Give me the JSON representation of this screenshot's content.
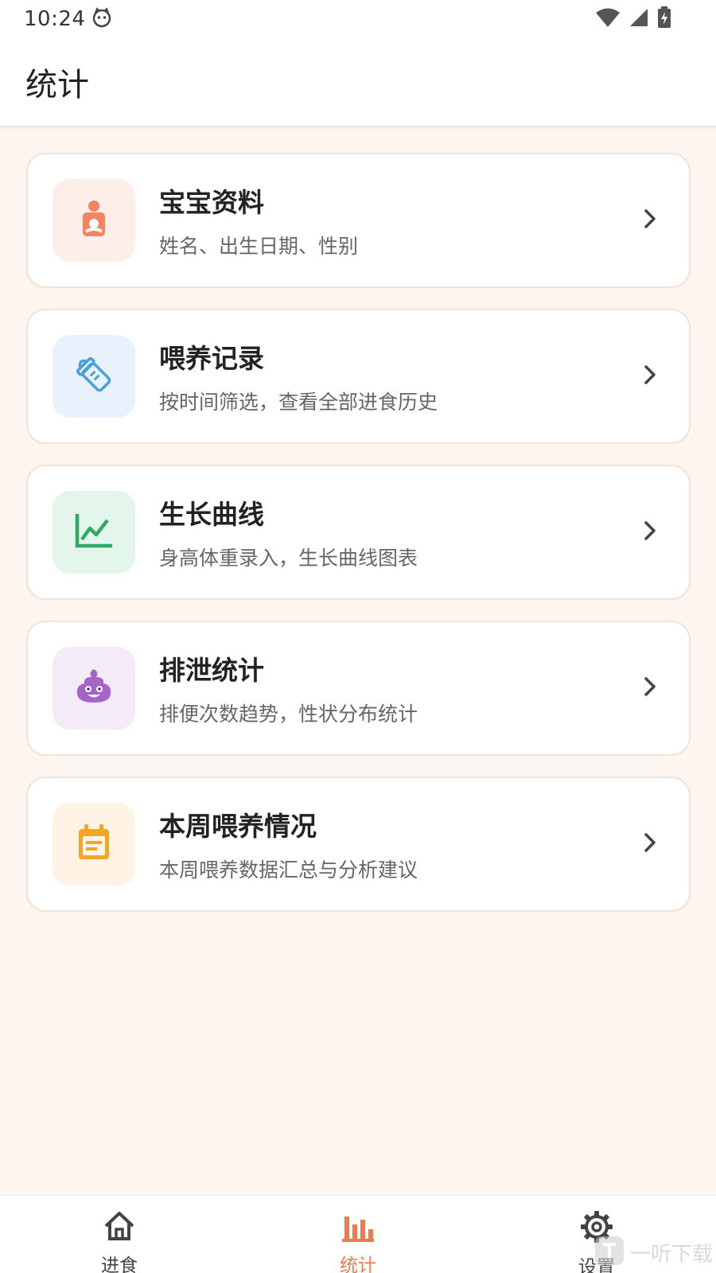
{
  "status": {
    "time": "10:24"
  },
  "header": {
    "title": "统计"
  },
  "items": [
    {
      "title": "宝宝资料",
      "subtitle": "姓名、出生日期、性别",
      "icon": "baby-icon",
      "bg": "#fdeeea",
      "color": "#f4845f"
    },
    {
      "title": "喂养记录",
      "subtitle": "按时间筛选，查看全部进食历史",
      "icon": "bottle-icon",
      "bg": "#e9f2fc",
      "color": "#4a9fdc"
    },
    {
      "title": "生长曲线",
      "subtitle": "身高体重录入，生长曲线图表",
      "icon": "growth-chart-icon",
      "bg": "#e4f5ec",
      "color": "#2eaa64"
    },
    {
      "title": "排泄统计",
      "subtitle": "排便次数趋势，性状分布统计",
      "icon": "poop-icon",
      "bg": "#f3ebf8",
      "color": "#a564c8"
    },
    {
      "title": "本周喂养情况",
      "subtitle": "本周喂养数据汇总与分析建议",
      "icon": "calendar-note-icon",
      "bg": "#fef3e4",
      "color": "#f5a623"
    }
  ],
  "nav": {
    "feed": "进食",
    "stats": "统计",
    "settings": "设置",
    "active_color": "#f07a4e"
  },
  "watermark": "一听下载"
}
